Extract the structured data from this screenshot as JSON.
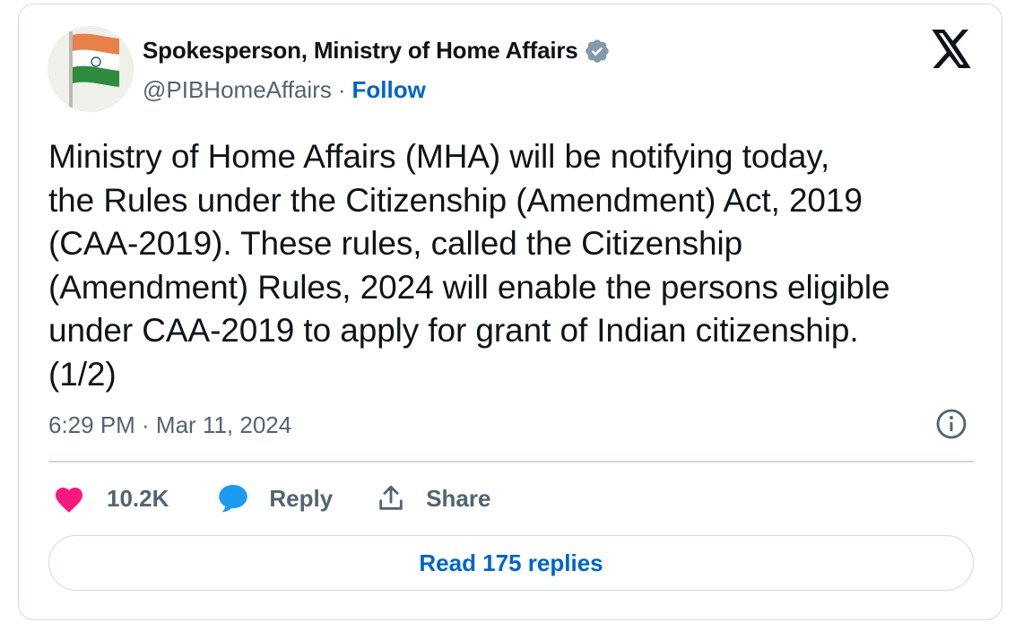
{
  "author": {
    "display_name": "Spokesperson, Ministry of Home Affairs",
    "handle": "@PIBHomeAffairs",
    "separator": "·",
    "follow_label": "Follow",
    "verified_badge_color": "#829aab"
  },
  "tweet": {
    "text": "Ministry of Home Affairs (MHA) will be notifying today,\nthe Rules under the Citizenship (Amendment) Act, 2019\n(CAA-2019). These rules, called the Citizenship\n(Amendment) Rules, 2024 will enable the persons eligible\nunder CAA-2019 to apply for grant of Indian citizenship.\n(1/2)",
    "timestamp": "6:29 PM · Mar 11, 2024"
  },
  "actions": {
    "like_count": "10.2K",
    "reply_label": "Reply",
    "share_label": "Share"
  },
  "read_replies_label": "Read 175 replies",
  "icons": {
    "brand": "x-logo-icon",
    "verified": "verified-badge-icon",
    "info": "info-icon",
    "like": "heart-icon",
    "reply": "reply-bubble-icon",
    "share": "share-icon"
  },
  "colors": {
    "text_primary": "#0f1419",
    "text_secondary": "#536471",
    "link_blue": "#0064c8",
    "heart_pink": "#f91880",
    "reply_blue": "#1d9bf0",
    "border": "#cfd9de"
  }
}
